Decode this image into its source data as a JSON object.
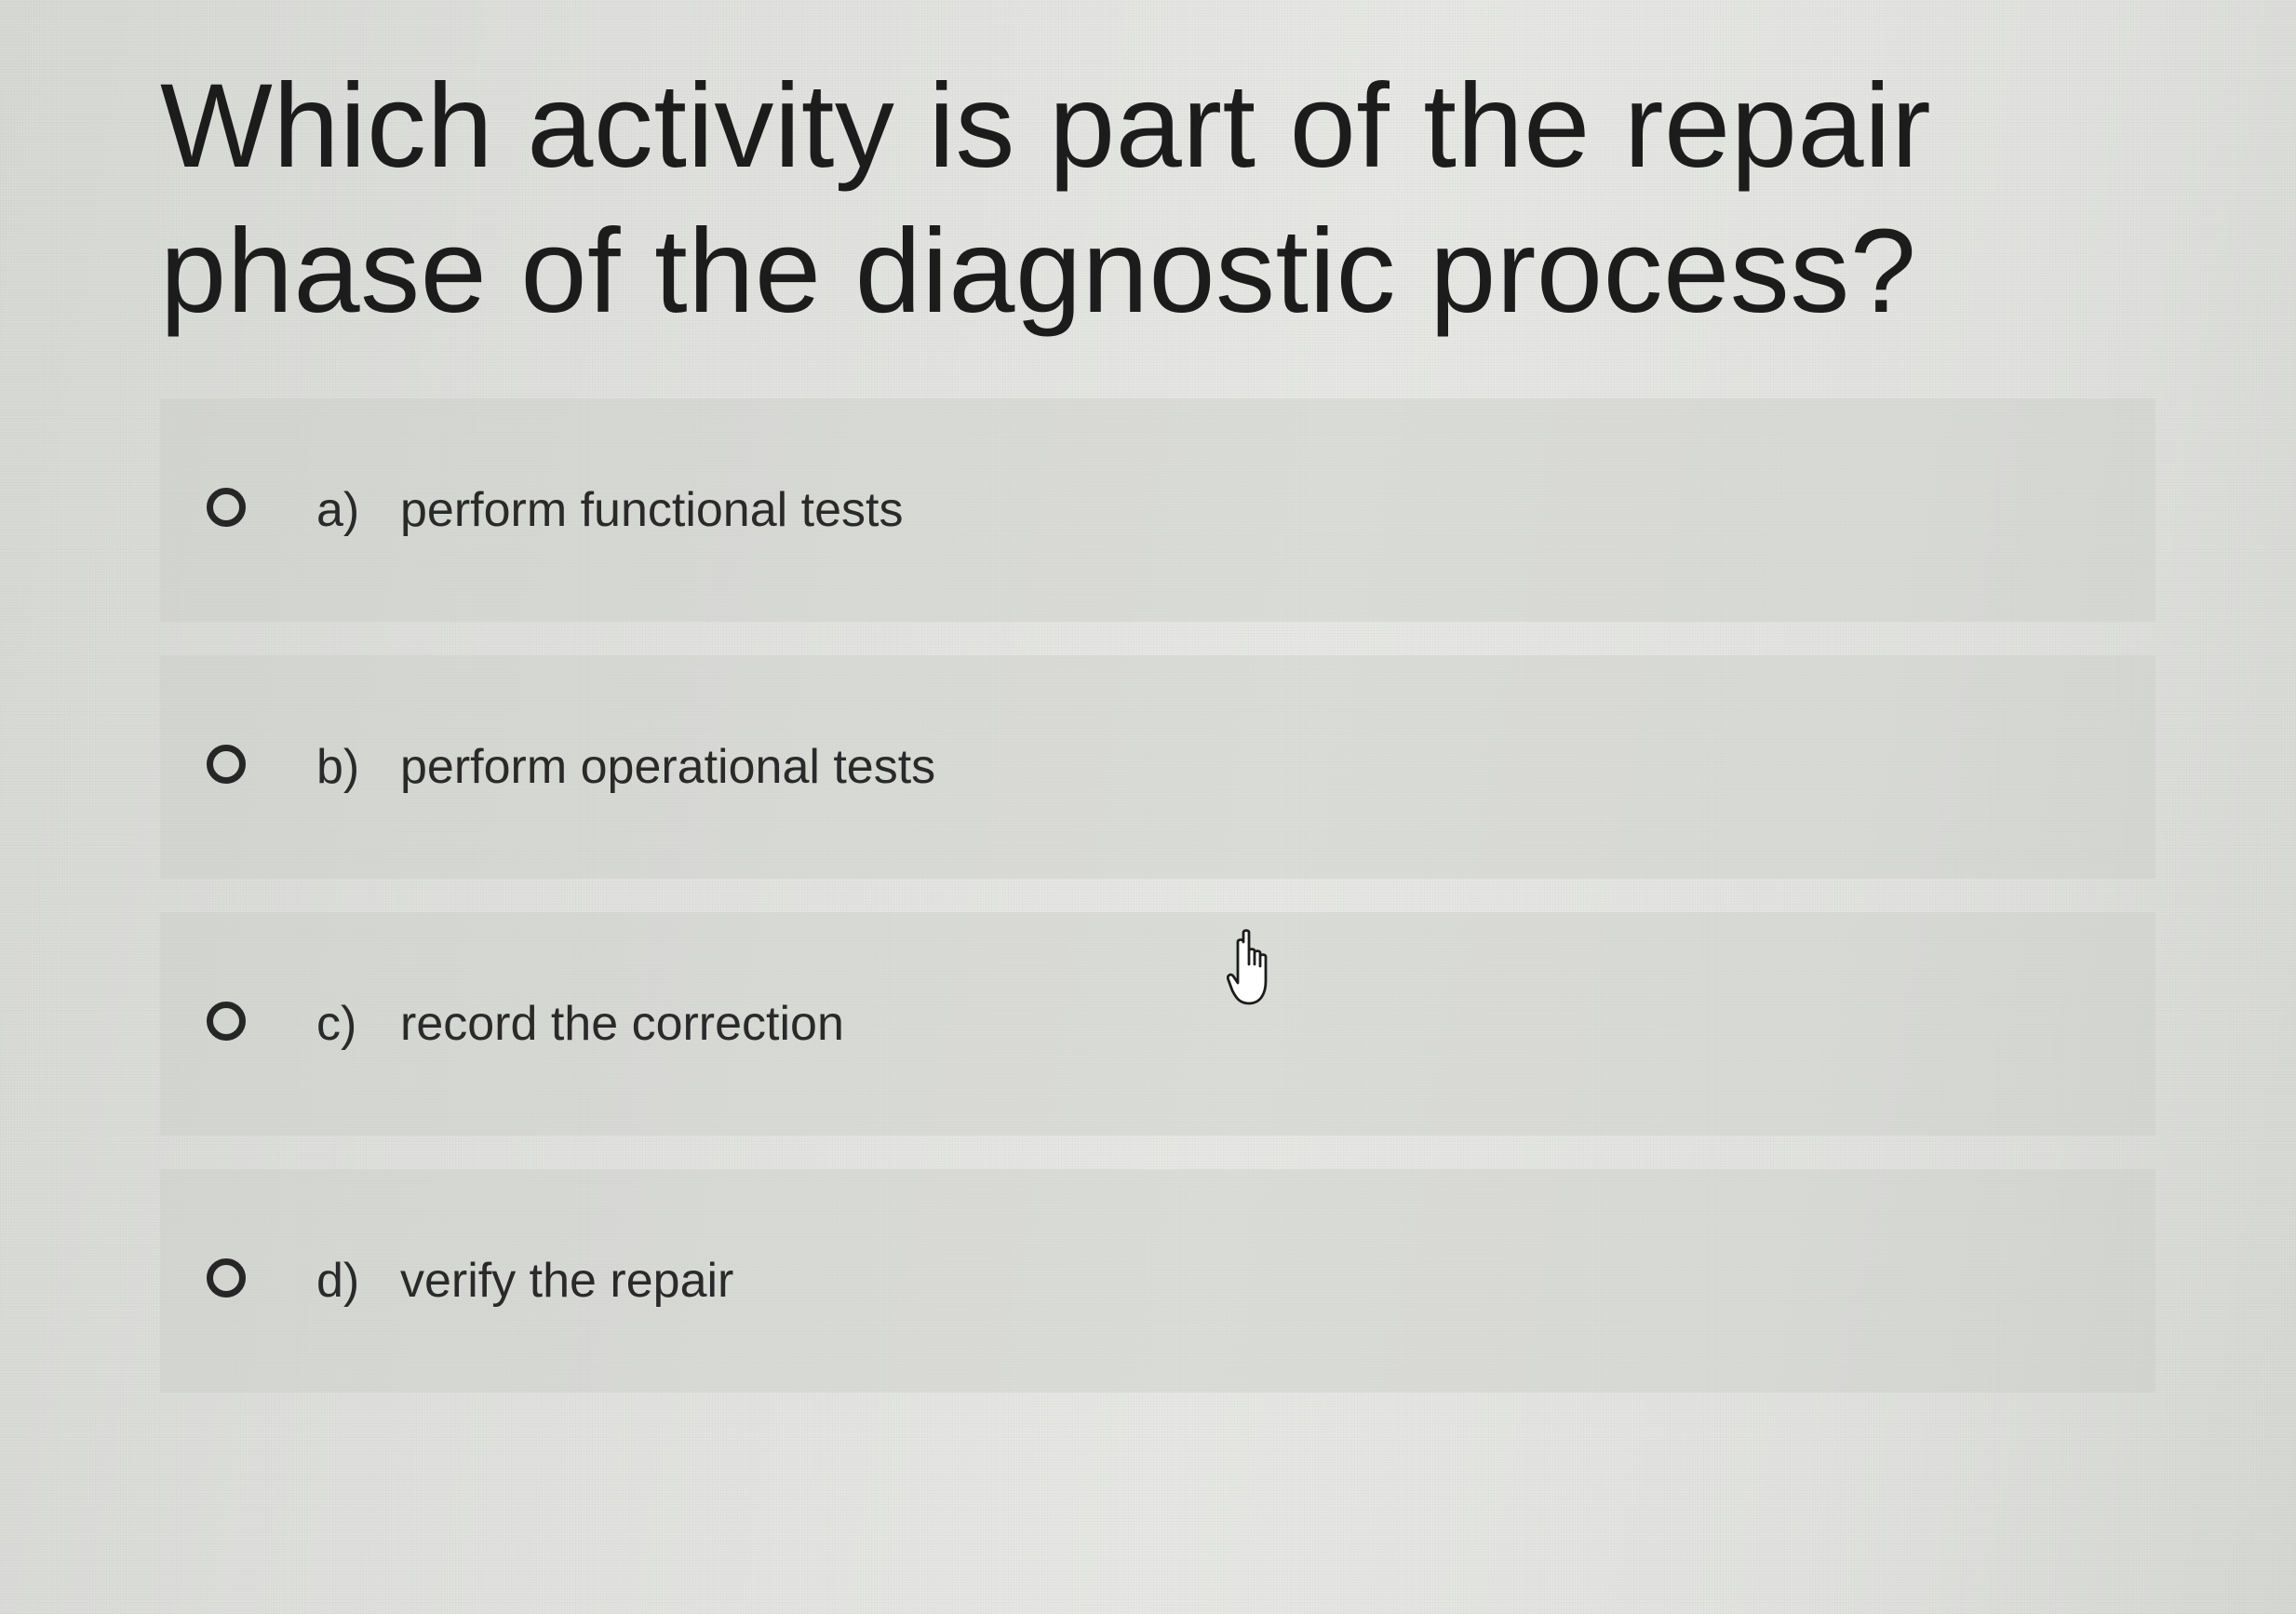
{
  "question": {
    "text": "Which activity is part of the repair phase of the diagnostic process?"
  },
  "options": [
    {
      "letter": "a)",
      "text": "perform functional tests",
      "selected": false
    },
    {
      "letter": "b)",
      "text": "perform operational tests",
      "selected": false
    },
    {
      "letter": "c)",
      "text": "record the correction",
      "selected": false
    },
    {
      "letter": "d)",
      "text": "verify the repair",
      "selected": false
    }
  ],
  "cursor": {
    "icon": "hand-pointer-icon"
  }
}
